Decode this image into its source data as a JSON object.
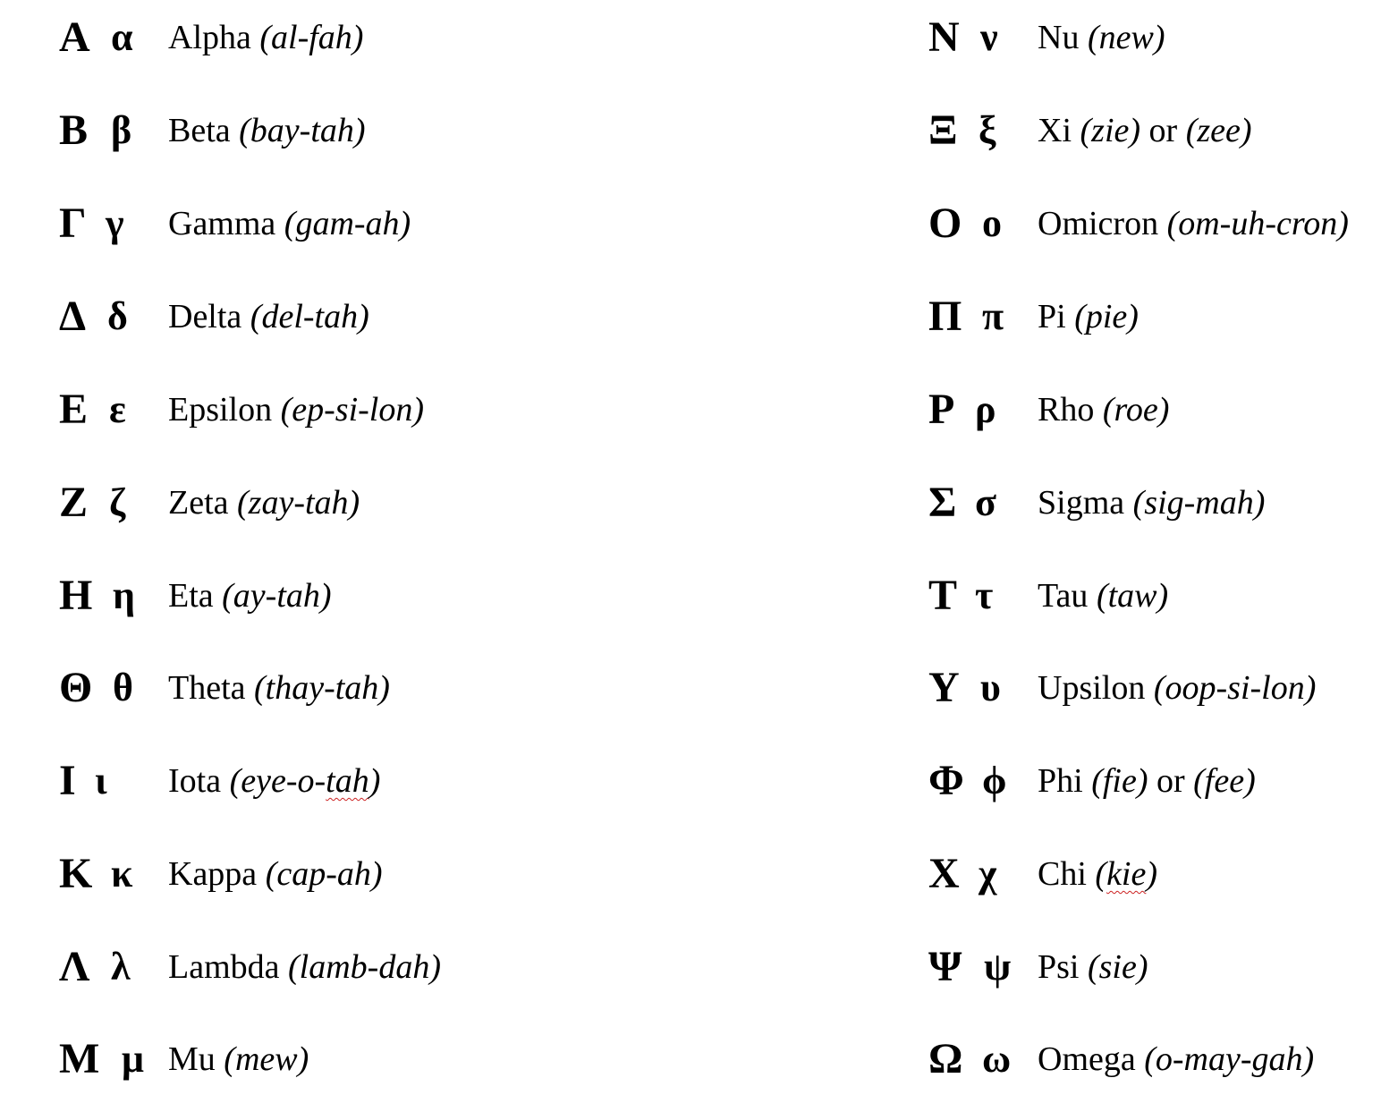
{
  "document": {
    "left_column": [
      {
        "upper": "Α",
        "lower": "α",
        "name": "Alpha",
        "pron": "(al-fah)"
      },
      {
        "upper": "Β",
        "lower": "β",
        "name": "Beta",
        "pron": "(bay-tah)"
      },
      {
        "upper": "Γ",
        "lower": "γ",
        "name": "Gamma",
        "pron": "(gam-ah)"
      },
      {
        "upper": "Δ",
        "lower": "δ",
        "name": "Delta",
        "pron": "(del-tah)"
      },
      {
        "upper": "Ε",
        "lower": "ε",
        "name": "Epsilon",
        "pron": "(ep-si-lon)"
      },
      {
        "upper": "Ζ",
        "lower": "ζ",
        "name": "Zeta",
        "pron": "(zay-tah)"
      },
      {
        "upper": "Η",
        "lower": "η",
        "name": "Eta",
        "pron": "(ay-tah)"
      },
      {
        "upper": "Θ",
        "lower": "θ",
        "name": "Theta",
        "pron": "(thay-tah)"
      },
      {
        "upper": "Ι",
        "lower": "ι",
        "name": "Iota",
        "pron_pre": "(eye-o-",
        "pron_flag": "tah",
        "pron_post": ")"
      },
      {
        "upper": "Κ",
        "lower": "κ",
        "name": "Kappa",
        "pron": "(cap-ah)"
      },
      {
        "upper": "Λ",
        "lower": "λ",
        "name": "Lambda",
        "pron": "(lamb-dah)"
      },
      {
        "upper": "Μ",
        "lower": "μ",
        "name": "Mu",
        "pron": "(mew)"
      }
    ],
    "right_column": [
      {
        "upper": "Ν",
        "lower": "ν",
        "name": "Nu",
        "pron": "(new)"
      },
      {
        "upper": "Ξ",
        "lower": "ξ",
        "name": "Xi",
        "pron": "(zie)",
        "conj": "or",
        "pron2": "(zee)"
      },
      {
        "upper": "Ο",
        "lower": "ο",
        "name": "Omicron",
        "pron": "(om-uh-cron)"
      },
      {
        "upper": "Π",
        "lower": "π",
        "name": "Pi",
        "pron": "(pie)"
      },
      {
        "upper": "Ρ",
        "lower": "ρ",
        "name": "Rho",
        "pron": "(roe)"
      },
      {
        "upper": "Σ",
        "lower": "σ",
        "name": "Sigma",
        "pron": "(sig-mah)"
      },
      {
        "upper": "Τ",
        "lower": "τ",
        "name": "Tau",
        "pron": "(taw)"
      },
      {
        "upper": "Υ",
        "lower": "υ",
        "name": "Upsilon",
        "pron": "(oop-si-lon)"
      },
      {
        "upper": "Φ",
        "lower": "ϕ",
        "name": "Phi",
        "pron": "(fie)",
        "conj": "or",
        "pron2": "(fee)"
      },
      {
        "upper": "Χ",
        "lower": "χ",
        "name": "Chi",
        "pron_pre": "(",
        "pron_flag": "kie",
        "pron_post": ")"
      },
      {
        "upper": "Ψ",
        "lower": "ψ",
        "name": "Psi",
        "pron": "(sie)"
      },
      {
        "upper": "Ω",
        "lower": "ω",
        "name": "Omega",
        "pron": "(o-may-gah)"
      }
    ]
  }
}
